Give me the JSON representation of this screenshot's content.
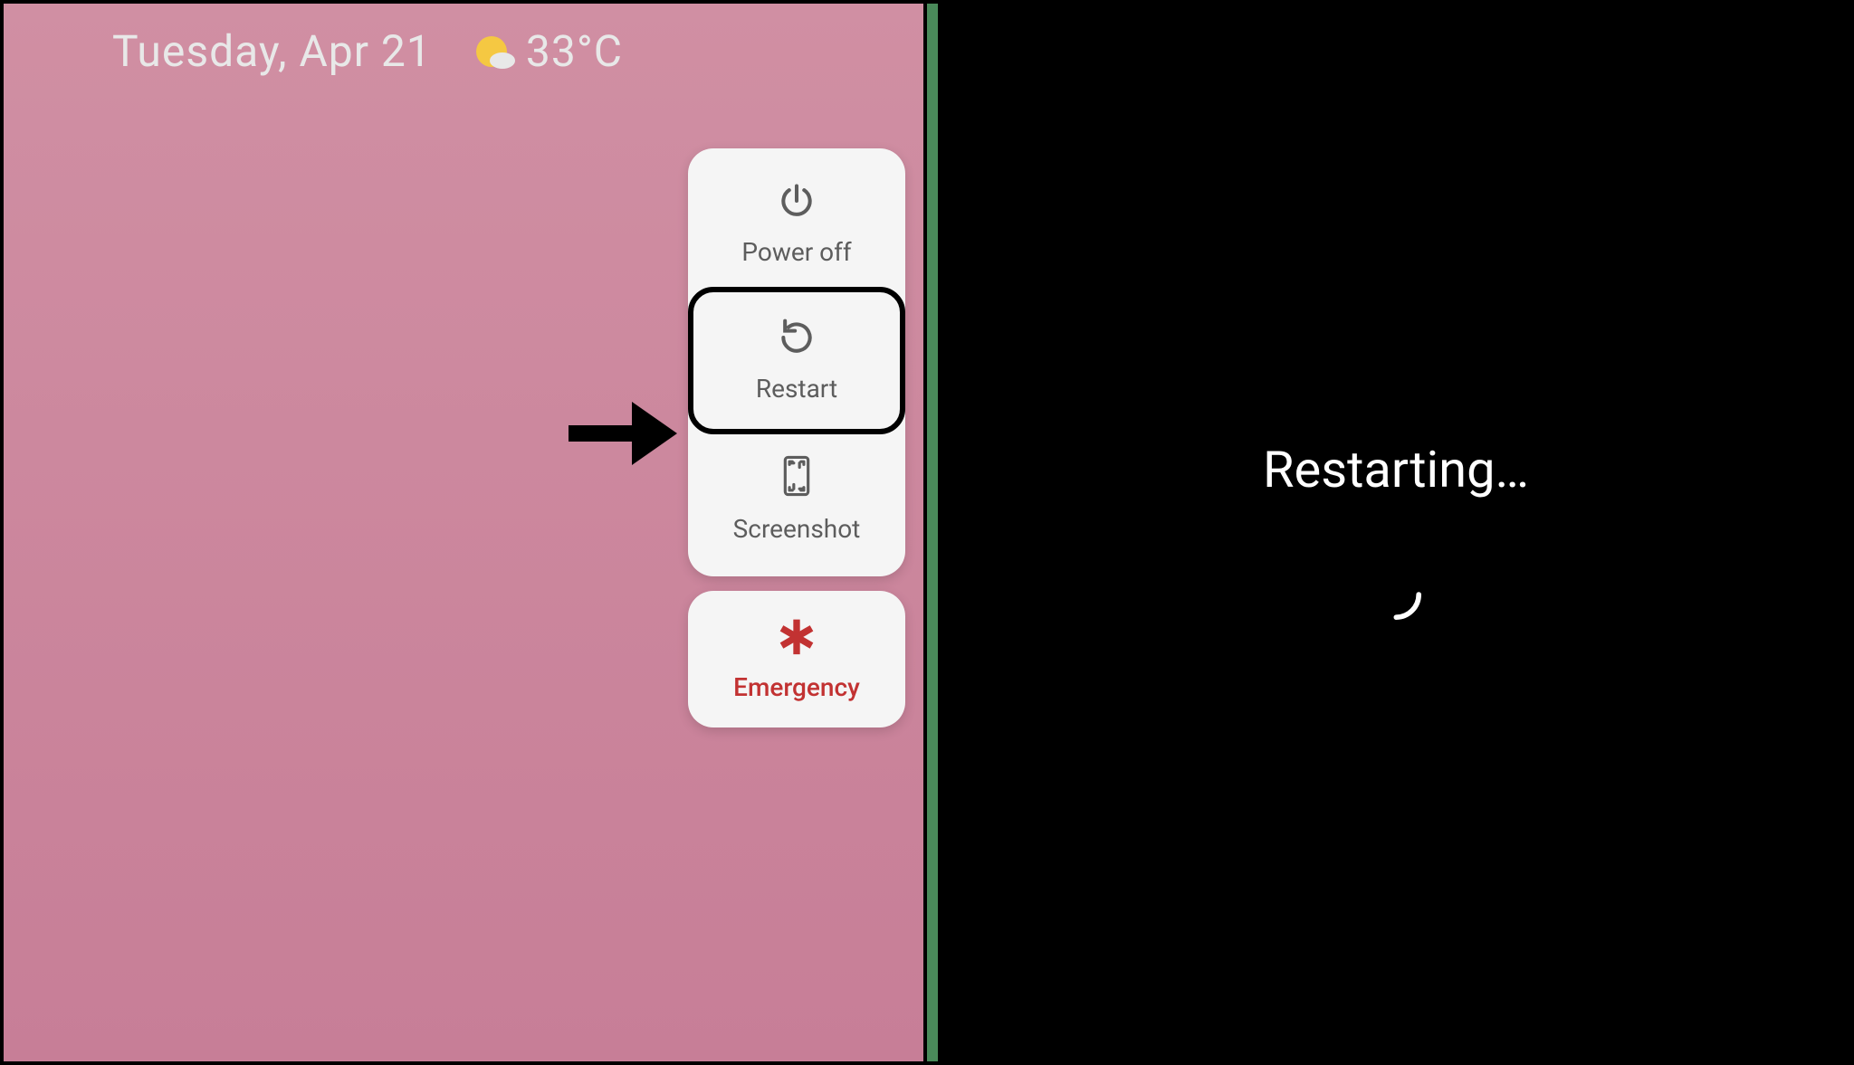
{
  "status": {
    "date": "Tuesday, Apr 21",
    "temperature": "33°C"
  },
  "powerMenu": {
    "powerOff": "Power off",
    "restart": "Restart",
    "screenshot": "Screenshot",
    "emergency": "Emergency"
  },
  "restartScreen": {
    "label": "Restarting…"
  }
}
